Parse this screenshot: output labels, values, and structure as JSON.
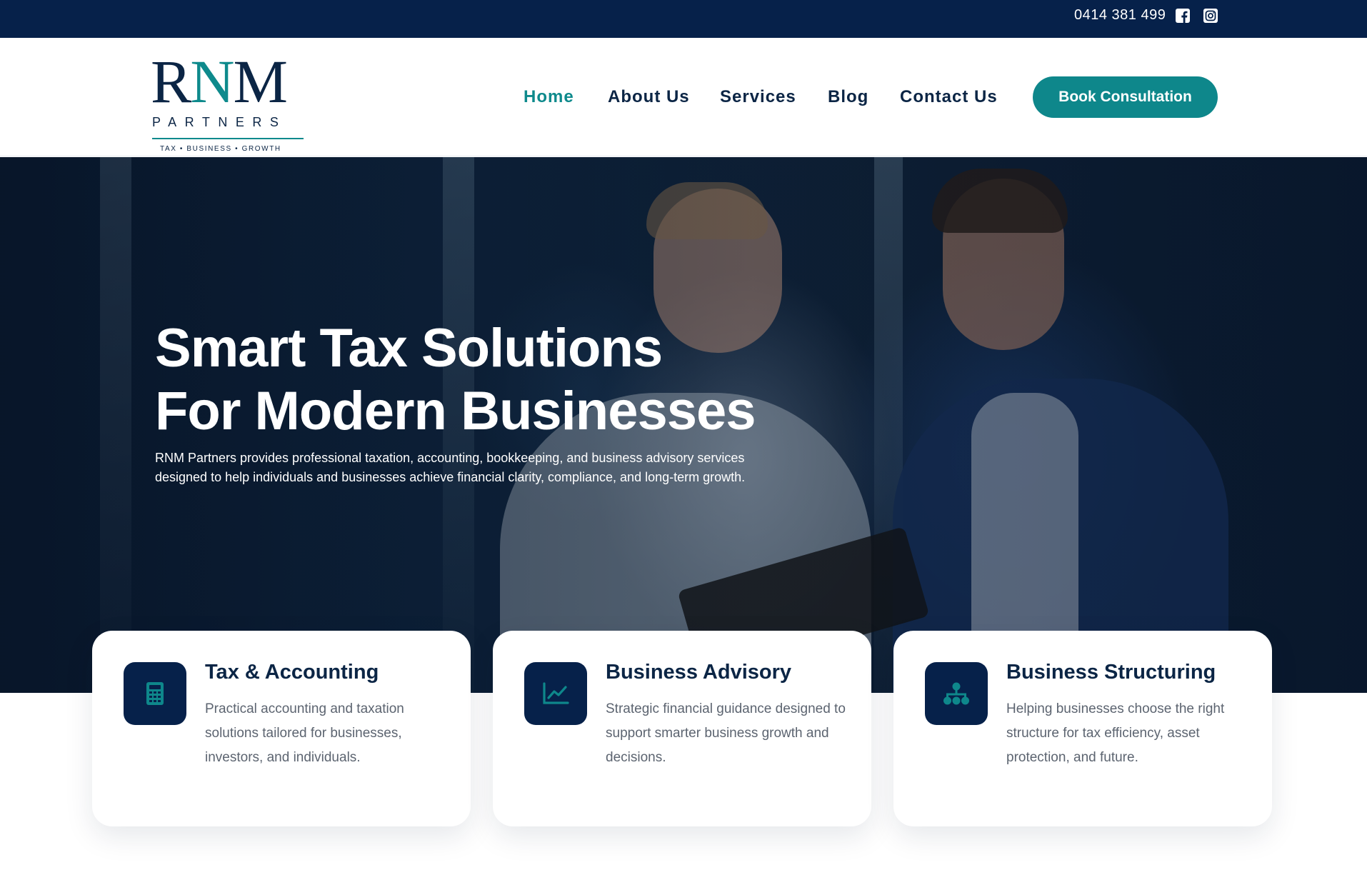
{
  "topbar": {
    "phone": "0414 381 499",
    "social": [
      {
        "icon": "facebook-icon"
      },
      {
        "icon": "instagram-icon"
      }
    ]
  },
  "logo": {
    "mark": "RNM",
    "subtitle": "PARTNERS",
    "tagline": "TAX  •  BUSINESS  •  GROWTH"
  },
  "nav": {
    "items": [
      {
        "label": "Home",
        "active": true
      },
      {
        "label": "About Us"
      },
      {
        "label": "Services"
      },
      {
        "label": "Blog"
      },
      {
        "label": "Contact Us"
      }
    ],
    "cta": "Book Consultation"
  },
  "hero": {
    "title_line1": "Smart Tax Solutions",
    "title_line2": "For Modern Businesses",
    "description": "RNM Partners provides professional taxation, accounting, bookkeeping, and business advisory services designed to help individuals and businesses achieve financial clarity, compliance, and long-term growth."
  },
  "cards": [
    {
      "icon": "calculator-icon",
      "title": "Tax & Accounting",
      "text": "Practical accounting and taxation solutions tailored for businesses, investors, and individuals."
    },
    {
      "icon": "line-chart-icon",
      "title": "Business Advisory",
      "text": "Strategic financial guidance designed to support smarter business growth and decisions."
    },
    {
      "icon": "org-chart-icon",
      "title": "Business Structuring",
      "text": "Helping businesses choose the right structure for tax efficiency, asset protection, and future."
    }
  ],
  "colors": {
    "navy": "#06214a",
    "teal": "#0e878b",
    "text_muted": "#5c6470"
  }
}
